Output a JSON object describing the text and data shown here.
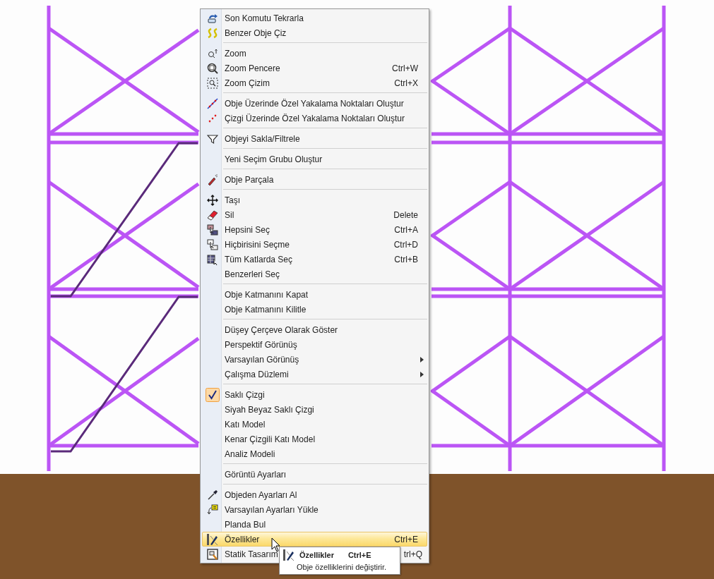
{
  "menu": {
    "groups": [
      {
        "items": [
          {
            "label": "Son Komutu Tekrarla"
          },
          {
            "label": "Benzer Obje Çiz"
          }
        ]
      },
      {
        "items": [
          {
            "label": "Zoom"
          },
          {
            "label": "Zoom Pencere",
            "shortcut": "Ctrl+W"
          },
          {
            "label": "Zoom Çizim",
            "shortcut": "Ctrl+X"
          }
        ]
      },
      {
        "items": [
          {
            "label": "Obje Üzerinde Özel Yakalama Noktaları Oluştur"
          },
          {
            "label": "Çizgi Üzerinde Özel Yakalama Noktaları Oluştur"
          }
        ]
      },
      {
        "items": [
          {
            "label": "Objeyi Sakla/Filtrele"
          }
        ]
      },
      {
        "items": [
          {
            "label": "Yeni Seçim Grubu Oluştur"
          }
        ]
      },
      {
        "items": [
          {
            "label": "Obje Parçala"
          }
        ]
      },
      {
        "items": [
          {
            "label": "Taşı"
          },
          {
            "label": "Sil",
            "shortcut": "Delete"
          },
          {
            "label": "Hepsini Seç",
            "shortcut": "Ctrl+A"
          },
          {
            "label": "Hiçbirisini Seçme",
            "shortcut": "Ctrl+D"
          },
          {
            "label": "Tüm Katlarda Seç",
            "shortcut": "Ctrl+B"
          },
          {
            "label": "Benzerleri Seç"
          }
        ]
      },
      {
        "items": [
          {
            "label": "Obje Katmanını Kapat"
          },
          {
            "label": "Obje Katmanını Kilitle"
          }
        ]
      },
      {
        "items": [
          {
            "label": "Düşey Çerçeve Olarak Göster",
            "submenu": false
          },
          {
            "label": "Perspektif Görünüş",
            "submenu": false
          },
          {
            "label": "Varsayılan Görünüş",
            "submenu": true
          },
          {
            "label": "Çalışma Düzlemi",
            "submenu": true
          }
        ]
      },
      {
        "items": [
          {
            "label": "Saklı Çizgi",
            "checked": true
          },
          {
            "label": "Siyah Beyaz Saklı Çizgi",
            "checked": false
          },
          {
            "label": "Katı Model",
            "checked": false
          },
          {
            "label": "Kenar Çizgili Katı Model",
            "checked": false
          },
          {
            "label": "Analiz Modeli",
            "checked": false
          }
        ]
      },
      {
        "items": [
          {
            "label": "Görüntü Ayarları"
          }
        ]
      },
      {
        "items": [
          {
            "label": "Objeden Ayarları Al",
            "selected": false
          },
          {
            "label": "Varsayılan Ayarları Yükle",
            "selected": false
          },
          {
            "label": "Planda Bul",
            "selected": false
          },
          {
            "label": "Özellikler",
            "shortcut": "Ctrl+E",
            "selected": true
          },
          {
            "label": "Statik Tasarım",
            "shortcut": "trl+Q",
            "selected": false
          }
        ]
      }
    ]
  },
  "tooltip": {
    "title": "Özellikler",
    "shortcut": "Ctrl+E",
    "description": "Obje özelliklerini değiştirir."
  }
}
